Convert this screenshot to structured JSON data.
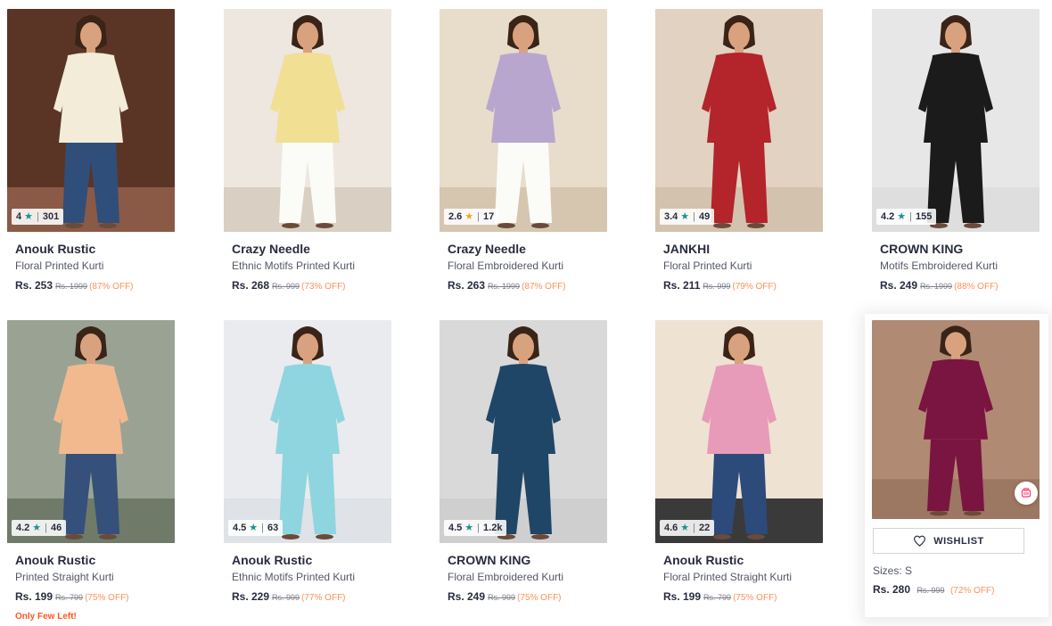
{
  "colors": {
    "rating_star_gold": "#f2a818",
    "rating_star_teal": "#14958f",
    "discount": "#ff905a",
    "urgency": "#ff5722"
  },
  "products": [
    {
      "brand": "Anouk Rustic",
      "product": "Floral Printed Kurti",
      "price": "Rs. 253",
      "mrp": "Rs. 1999",
      "discount": "(87% OFF)",
      "rating": "4",
      "star": "teal",
      "ratings_count": "301",
      "urgency": "",
      "image": {
        "bg": "#5a3526",
        "floor": "#8a5a46",
        "top": "#f2ecd9",
        "bottom": "#2f4f7a"
      }
    },
    {
      "brand": "Crazy Needle",
      "product": "Ethnic Motifs Printed Kurti",
      "price": "Rs. 268",
      "mrp": "Rs. 999",
      "discount": "(73% OFF)",
      "rating": "",
      "star": "",
      "ratings_count": "",
      "urgency": "",
      "image": {
        "bg": "#ede7df",
        "floor": "#d9cfc3",
        "top": "#f1df94",
        "bottom": "#fbfbf8"
      }
    },
    {
      "brand": "Crazy Needle",
      "product": "Floral Embroidered Kurti",
      "price": "Rs. 263",
      "mrp": "Rs. 1999",
      "discount": "(87% OFF)",
      "rating": "2.6",
      "star": "gold",
      "ratings_count": "17",
      "urgency": "",
      "image": {
        "bg": "#e8dccb",
        "floor": "#d6c6b0",
        "top": "#b9a6cf",
        "bottom": "#fbfbf8"
      }
    },
    {
      "brand": "JANKHI",
      "product": "Floral Printed Kurti",
      "price": "Rs. 211",
      "mrp": "Rs. 999",
      "discount": "(79% OFF)",
      "rating": "3.4",
      "star": "teal",
      "ratings_count": "49",
      "urgency": "",
      "image": {
        "bg": "#e1d2c1",
        "floor": "#d3c2ae",
        "top": "#b3242b",
        "bottom": "#b3242b"
      }
    },
    {
      "brand": "CROWN KING",
      "product": "Motifs Embroidered Kurti",
      "price": "Rs. 249",
      "mrp": "Rs. 1999",
      "discount": "(88% OFF)",
      "rating": "4.2",
      "star": "teal",
      "ratings_count": "155",
      "urgency": "",
      "image": {
        "bg": "#e7e7e7",
        "floor": "#dedede",
        "top": "#1b1b1b",
        "bottom": "#1b1b1b"
      }
    },
    {
      "brand": "Anouk Rustic",
      "product": "Printed Straight Kurti",
      "price": "Rs. 199",
      "mrp": "Rs. 799",
      "discount": "(75% OFF)",
      "rating": "4.2",
      "star": "teal",
      "ratings_count": "46",
      "urgency": "Only Few Left!",
      "image": {
        "bg": "#9aa393",
        "floor": "#6f7a68",
        "top": "#f2b98f",
        "bottom": "#35507a"
      }
    },
    {
      "brand": "Anouk Rustic",
      "product": "Ethnic Motifs Printed Kurti",
      "price": "Rs. 229",
      "mrp": "Rs. 999",
      "discount": "(77% OFF)",
      "rating": "4.5",
      "star": "teal",
      "ratings_count": "63",
      "urgency": "",
      "image": {
        "bg": "#e9ebee",
        "floor": "#dfe2e6",
        "top": "#8fd5df",
        "bottom": "#8fd5df"
      }
    },
    {
      "brand": "CROWN KING",
      "product": "Floral Embroidered Kurti",
      "price": "Rs. 249",
      "mrp": "Rs. 999",
      "discount": "(75% OFF)",
      "rating": "4.5",
      "star": "teal",
      "ratings_count": "1.2k",
      "urgency": "",
      "image": {
        "bg": "#d9d9d9",
        "floor": "#cfcfcf",
        "top": "#1f4666",
        "bottom": "#1f4666"
      }
    },
    {
      "brand": "Anouk Rustic",
      "product": "Floral Printed Straight Kurti",
      "price": "Rs. 199",
      "mrp": "Rs. 799",
      "discount": "(75% OFF)",
      "rating": "4.6",
      "star": "teal",
      "ratings_count": "22",
      "urgency": "",
      "image": {
        "bg": "#eee2d3",
        "floor": "#3a3a3a",
        "top": "#e79bb8",
        "bottom": "#2c4a7a"
      }
    }
  ],
  "hovered_product": {
    "wishlist_label": "WISHLIST",
    "sizes": "Sizes: S",
    "price": "Rs. 280",
    "mrp": "Rs. 999",
    "discount": "(72% OFF)",
    "similar_icon": "view-similar-icon",
    "image": {
      "bg": "#b08a73",
      "floor": "#9c7761",
      "top": "#7a1440",
      "bottom": "#7a1440"
    }
  }
}
